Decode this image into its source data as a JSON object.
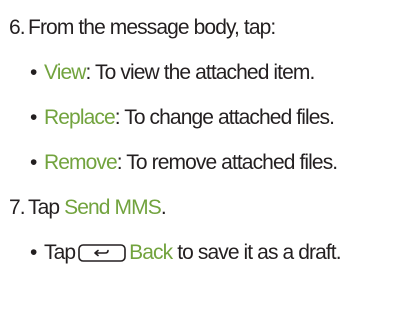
{
  "steps": [
    {
      "number": "6.",
      "text": "From the message body, tap:",
      "bullets": [
        {
          "bullet": "•",
          "keyword": "View",
          "text": ": To view the attached item."
        },
        {
          "bullet": "•",
          "keyword": "Replace",
          "text": ": To change attached files."
        },
        {
          "bullet": "•",
          "keyword": "Remove",
          "text": ": To remove attached files."
        }
      ]
    },
    {
      "number": "7.",
      "text_before": "Tap ",
      "keyword": "Send MMS",
      "text_after": ".",
      "bullets": [
        {
          "bullet": "•",
          "text_before": "Tap",
          "icon": "back-key-icon",
          "keyword": "Back",
          "text_after": " to save it as a draft."
        }
      ]
    }
  ],
  "colors": {
    "text": "#231f20",
    "keyword": "#72a33e"
  }
}
